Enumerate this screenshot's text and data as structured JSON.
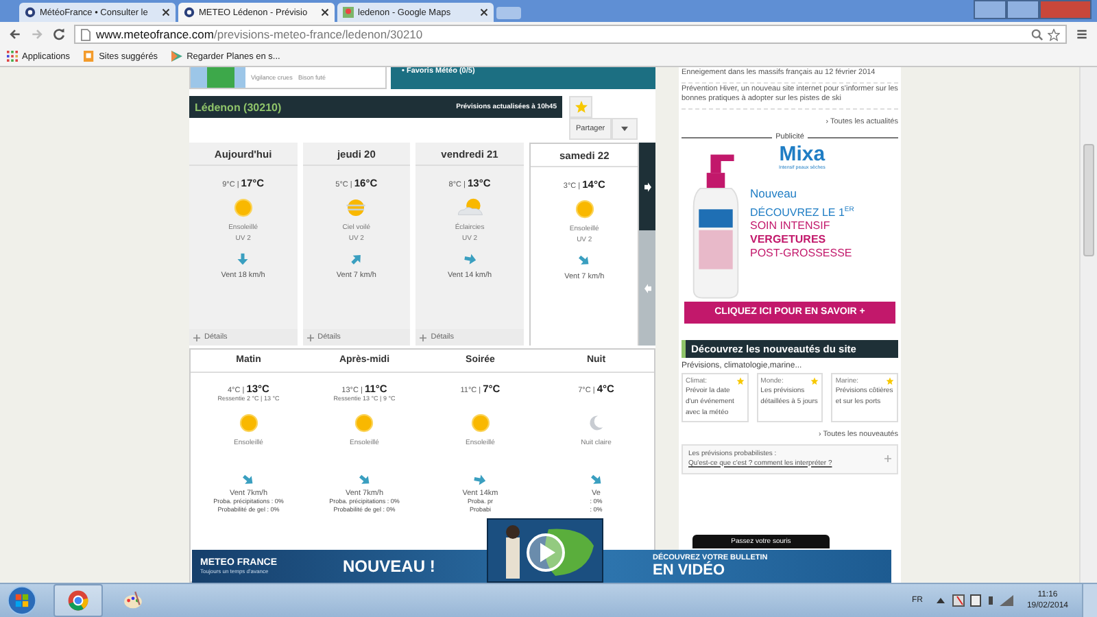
{
  "browser": {
    "tabs": [
      {
        "title": "MétéoFrance • Consulter le",
        "selected": false,
        "kind": "meteo"
      },
      {
        "title": "METEO Lédenon - Prévisio",
        "selected": true,
        "kind": "meteo"
      },
      {
        "title": "ledenon - Google Maps",
        "selected": false,
        "kind": "maps"
      }
    ],
    "url": {
      "host": "www.meteofrance.com",
      "path": "/previsions-meteo-france/ledenon/30210"
    },
    "bookmarks": [
      {
        "label": "Applications",
        "kind": "apps"
      },
      {
        "label": "Sites suggérés",
        "kind": "page"
      },
      {
        "label": "Regarder Planes en s...",
        "kind": "play"
      }
    ]
  },
  "top_strip": {
    "map_links": [
      "Vigilance crues",
      "Bison futé"
    ],
    "favorites": "• Favoris Météo (0/5)"
  },
  "location": {
    "name": "Lédenon (30210)",
    "updated": "Prévisions actualisées à 10h45",
    "share": "Partager"
  },
  "days": [
    {
      "label": "Aujourd'hui",
      "min": "9°C |",
      "max": "17°C",
      "weather": {
        "kind": "sun",
        "description": "Ensoleillé"
      },
      "uv": "UV 2",
      "wind": {
        "kind": "down",
        "speed": "Vent 18 km/h"
      },
      "details": "Détails",
      "selected": false
    },
    {
      "label": "jeudi 20",
      "min": "5°C |",
      "max": "16°C",
      "weather": {
        "kind": "veiled",
        "description": "Ciel voilé"
      },
      "uv": "UV 2",
      "wind": {
        "kind": "up-right",
        "speed": "Vent 7 km/h"
      },
      "details": "Détails",
      "selected": false
    },
    {
      "label": "vendredi 21",
      "min": "8°C |",
      "max": "13°C",
      "weather": {
        "kind": "partly",
        "description": "Éclaircies"
      },
      "uv": "UV 2",
      "wind": {
        "kind": "right",
        "speed": "Vent 14 km/h"
      },
      "details": "Détails",
      "selected": false
    },
    {
      "label": "samedi 22",
      "min": "3°C |",
      "max": "14°C",
      "weather": {
        "kind": "sun",
        "description": "Ensoleillé"
      },
      "uv": "UV 2",
      "wind": {
        "kind": "down-right",
        "speed": "Vent 7 km/h"
      },
      "selected": true
    }
  ],
  "periods": [
    {
      "label": "Matin",
      "min": "4°C |",
      "max": "13°C",
      "feels": "Ressentie 2 °C | 13 °C",
      "weather": {
        "kind": "sun",
        "description": "Ensoleillé"
      },
      "wind": {
        "kind": "down-right",
        "speed": "Vent 7km/h"
      },
      "rain": "Proba. précipitations : 0%",
      "frost": "Probabilité de gel : 0%"
    },
    {
      "label": "Après-midi",
      "min": "13°C |",
      "max": "11°C",
      "feels": "Ressentie 13 °C | 9 °C",
      "weather": {
        "kind": "sun",
        "description": "Ensoleillé"
      },
      "wind": {
        "kind": "down-right",
        "speed": "Vent 7km/h"
      },
      "rain": "Proba. précipitations : 0%",
      "frost": "Probabilité de gel : 0%"
    },
    {
      "label": "Soirée",
      "min": "11°C |",
      "max": "7°C",
      "weather": {
        "kind": "sun",
        "description": "Ensoleillé"
      },
      "wind": {
        "kind": "right",
        "speed": "Vent 14km"
      },
      "rain": "Proba. pr",
      "frost": "Probabi"
    },
    {
      "label": "Nuit",
      "min": "7°C |",
      "max": "4°C",
      "weather": {
        "kind": "moon",
        "description": "Nuit claire"
      },
      "wind": {
        "kind": "down-right",
        "speed": "Ve"
      },
      "rain": ": 0%",
      "frost": ": 0%"
    }
  ],
  "news": {
    "items": [
      "Enneigement dans les massifs français au 12 février 2014",
      "Prévention Hiver, un nouveau site internet pour s'informer sur les bonnes pratiques à adopter sur les pistes de ski"
    ],
    "all_link": "› Toutes les actualités"
  },
  "advert": {
    "label": "Publicité",
    "brand": "Mixa",
    "brand_tagline": "Intensif peaux sèches",
    "lines": [
      "Nouveau",
      "DÉCOUVREZ LE 1$^{ER}$",
      "SOIN INTENSIF",
      "VERGETURES",
      "POST-GROSSESSE"
    ],
    "cta": "CLIQUEZ ICI POUR EN SAVOIR +"
  },
  "novelties": {
    "title": "Découvrez les nouveautés du site",
    "subtitle": "Prévisions, climatologie,marine...",
    "cards": [
      {
        "title": "Climat:",
        "text": "Prévoir la date d'un événement avec la météo"
      },
      {
        "title": "Monde:",
        "text": "Les prévisions détaillées à 5 jours"
      },
      {
        "title": "Marine:",
        "text": "Prévisions côtières et sur les ports"
      }
    ],
    "all_link": "› Toutes les nouveautés",
    "faq_line1": "Les prévisions probabilistes :",
    "faq_line2": "Qu'est-ce que c'est ? comment les interpréter ?"
  },
  "video_banner": {
    "brand": "METEO FRANCE",
    "tagline": "Toujours un temps d'avance",
    "headline": "NOUVEAU !",
    "cta_line1": "DÉCOUVREZ VOTRE BULLETIN",
    "cta_line2": "EN VIDÉO",
    "tooltip": "Passez votre souris"
  },
  "taskbar": {
    "apps": [
      {
        "kind": "chrome",
        "selected": true
      },
      {
        "kind": "paint",
        "selected": false
      }
    ],
    "language": "FR",
    "time": "11:16",
    "date": "19/02/2014"
  }
}
